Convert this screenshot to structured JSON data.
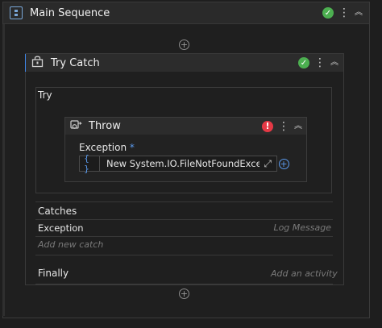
{
  "main_sequence": {
    "title": "Main Sequence"
  },
  "try_catch": {
    "title": "Try Catch",
    "try_label": "Try",
    "throw": {
      "title": "Throw",
      "field_label": "Exception",
      "required_mark": "*",
      "expr_prefix": "{ }",
      "value": "New System.IO.FileNotFoundExceptio"
    },
    "catches_label": "Catches",
    "catch_row": {
      "exception": "Exception",
      "action": "Log Message"
    },
    "add_new_catch": "Add new catch",
    "finally_label": "Finally",
    "add_activity": "Add an activity"
  },
  "colors": {
    "accent": "#3f86e8",
    "success": "#4caf50",
    "error": "#e53945"
  }
}
